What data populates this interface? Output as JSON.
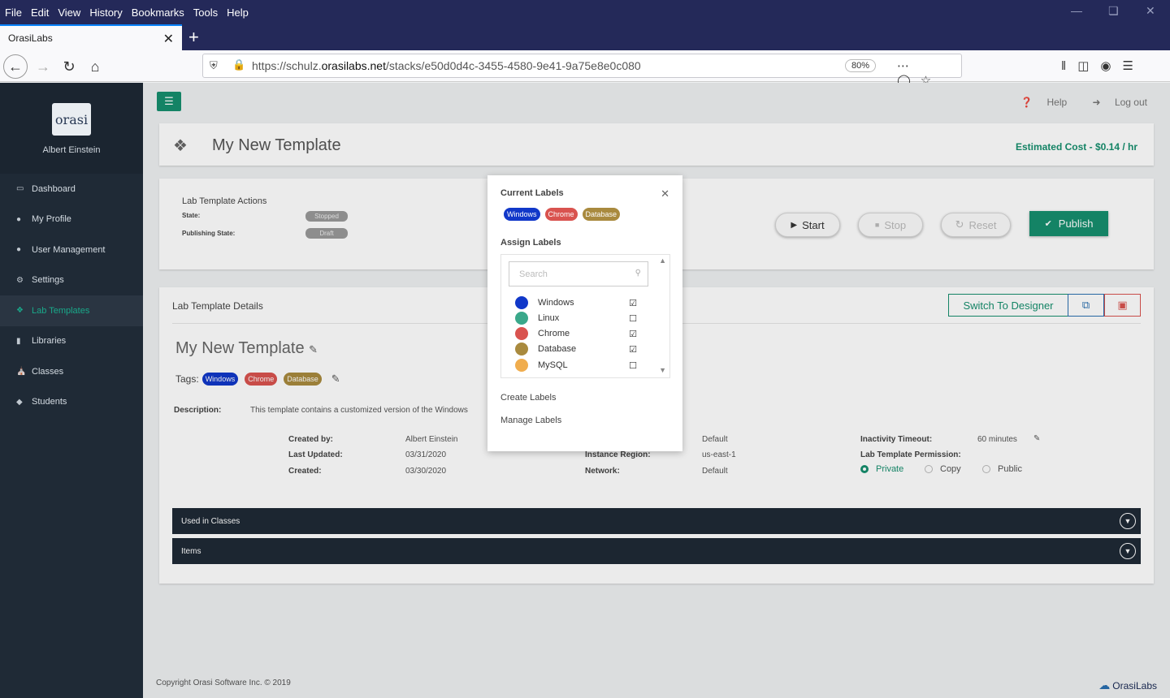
{
  "browser": {
    "menu": [
      "File",
      "Edit",
      "View",
      "History",
      "Bookmarks",
      "Tools",
      "Help"
    ],
    "tab_title": "OrasiLabs",
    "url_prefix": "https://schulz.",
    "url_host": "orasilabs.net",
    "url_path": "/stacks/e50d0d4c-3455-4580-9e41-9a75e8e0c080",
    "zoom": "80%"
  },
  "sidebar": {
    "user_name": "Albert Einstein",
    "logo_text": "orasi",
    "items": [
      {
        "label": "Dashboard",
        "icon": "monitor-icon"
      },
      {
        "label": "My Profile",
        "icon": "user-icon"
      },
      {
        "label": "User Management",
        "icon": "users-icon"
      },
      {
        "label": "Settings",
        "icon": "gear-icon"
      },
      {
        "label": "Lab Templates",
        "icon": "cubes-icon",
        "active": true
      },
      {
        "label": "Libraries",
        "icon": "book-icon"
      },
      {
        "label": "Classes",
        "icon": "institution-icon"
      },
      {
        "label": "Students",
        "icon": "graduation-cap-icon"
      }
    ]
  },
  "header": {
    "help": "Help",
    "logout": "Log out"
  },
  "template": {
    "title": "My New Template",
    "cost": "Estimated Cost - $0.14 / hr"
  },
  "actions": {
    "title": "Lab Template Actions",
    "state_label": "State:",
    "state_value": "Stopped",
    "publishing_label": "Publishing State:",
    "publishing_value": "Draft",
    "start": "Start",
    "stop": "Stop",
    "reset": "Reset",
    "publish": "Publish"
  },
  "details": {
    "title": "Lab Template Details",
    "switch_designer": "Switch To Designer",
    "name": "My New Template",
    "tags_label": "Tags:",
    "tags": [
      {
        "name": "Windows",
        "color": "#1138c9"
      },
      {
        "name": "Chrome",
        "color": "#d9534f"
      },
      {
        "name": "Database",
        "color": "#a98a3e"
      }
    ],
    "description_label": "Description:",
    "description": "This template contains a customized version of the Windows",
    "created_by_label": "Created by:",
    "created_by": "Albert Einstein",
    "last_updated_label": "Last Updated:",
    "last_updated": "03/31/2020",
    "created_label": "Created:",
    "created": "03/30/2020",
    "instance_type_value": "Default",
    "instance_region_label": "Instance Region:",
    "instance_region": "us-east-1",
    "network_label": "Network:",
    "network": "Default",
    "inactivity_label": "Inactivity Timeout:",
    "inactivity": "60 minutes",
    "permission_label": "Lab Template Permission:",
    "permission_options": [
      "Private",
      "Copy",
      "Public"
    ],
    "permission_selected": "Private",
    "used_in_classes": "Used in Classes",
    "items": "Items"
  },
  "footer": {
    "copyright": "Copyright Orasi Software Inc. © 2019",
    "brand": "OrasiLabs"
  },
  "modal": {
    "current_labels_title": "Current Labels",
    "current_labels": [
      {
        "name": "Windows",
        "color": "#1138c9"
      },
      {
        "name": "Chrome",
        "color": "#d9534f"
      },
      {
        "name": "Database",
        "color": "#a98a3e"
      }
    ],
    "assign_labels_title": "Assign Labels",
    "search_placeholder": "Search",
    "labels": [
      {
        "name": "Windows",
        "color": "#1138c9",
        "checked": true
      },
      {
        "name": "Linux",
        "color": "#3aa88a",
        "checked": false
      },
      {
        "name": "Chrome",
        "color": "#d9534f",
        "checked": true
      },
      {
        "name": "Database",
        "color": "#a98a3e",
        "checked": true
      },
      {
        "name": "MySQL",
        "color": "#f0ad4e",
        "checked": false
      }
    ],
    "create_labels": "Create Labels",
    "manage_labels": "Manage Labels"
  }
}
